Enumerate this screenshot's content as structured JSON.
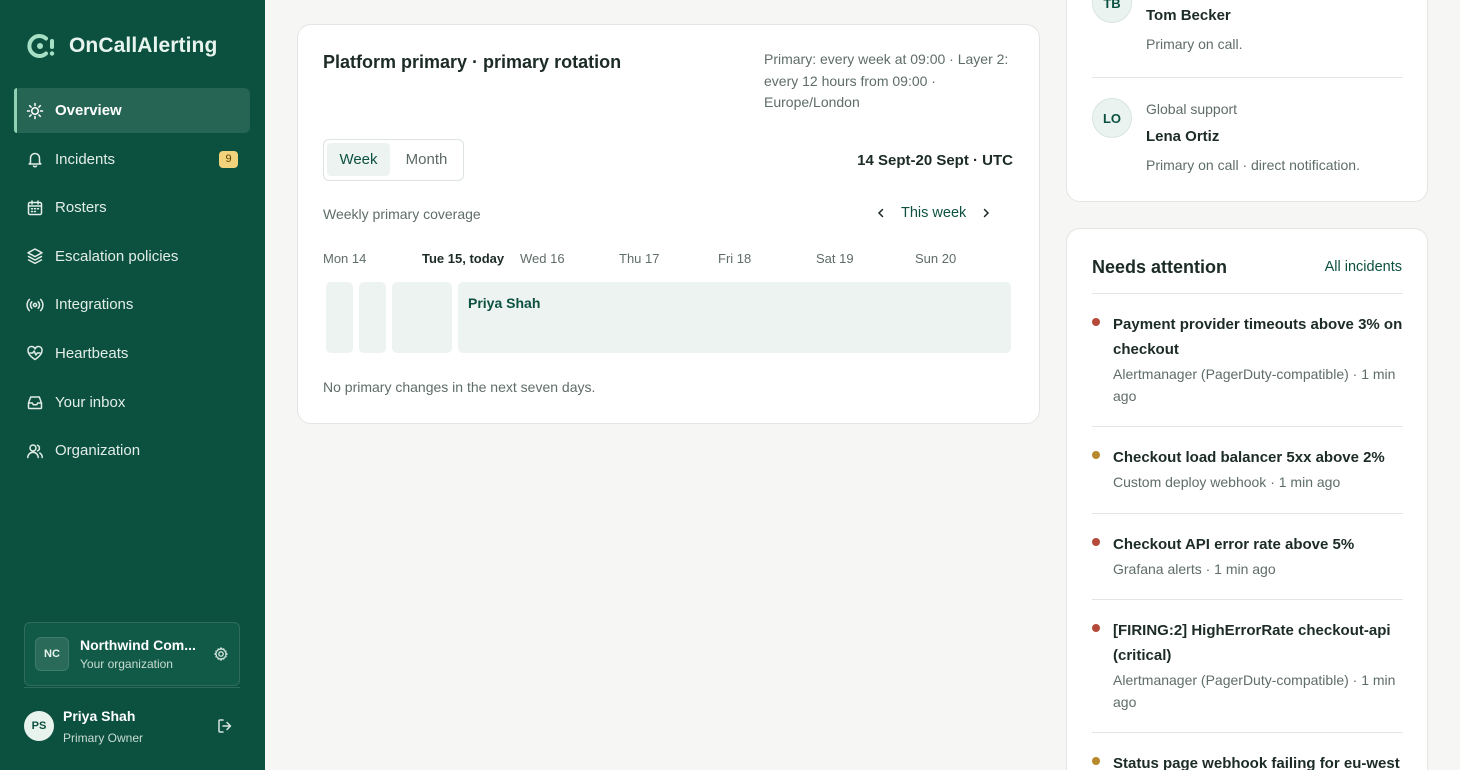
{
  "app": {
    "name": "OnCallAlerting"
  },
  "colors": {
    "sidebar": "#0c5140",
    "accent": "#0c5140",
    "critical": "#b54a3b",
    "warning": "#b8892a",
    "badge": "#f2d27a"
  },
  "nav": {
    "items": [
      {
        "label": "Overview",
        "icon": "sun-icon",
        "active": true
      },
      {
        "label": "Incidents",
        "icon": "bell-icon",
        "badge": "9"
      },
      {
        "label": "Rosters",
        "icon": "calendar-icon"
      },
      {
        "label": "Escalation policies",
        "icon": "layers-icon"
      },
      {
        "label": "Integrations",
        "icon": "broadcast-icon"
      },
      {
        "label": "Heartbeats",
        "icon": "heart-pulse-icon"
      },
      {
        "label": "Your inbox",
        "icon": "inbox-icon"
      },
      {
        "label": "Organization",
        "icon": "users-icon"
      }
    ]
  },
  "org": {
    "initials": "NC",
    "name": "Northwind Com...",
    "role": "Your organization"
  },
  "user": {
    "initials": "PS",
    "name": "Priya Shah",
    "role": "Primary Owner"
  },
  "rotation": {
    "title": "Platform primary · primary rotation",
    "schedule": "Primary: every week at 09:00 · Layer 2: every 12 hours from 09:00 · Europe/London",
    "view_tabs": [
      "Week",
      "Month"
    ],
    "active_tab": "Week",
    "range": "14 Sept-20 Sept · UTC",
    "coverage_label": "Weekly primary coverage",
    "nav_label": "This week",
    "days": [
      "Mon 14",
      "Tue 15, today",
      "Wed 16",
      "Thu 17",
      "Fri 18",
      "Sat 19",
      "Sun 20"
    ],
    "today_index": 1,
    "shift_name": "Priya Shah",
    "footer": "No primary changes in the next seven days."
  },
  "oncall": [
    {
      "initials": "TB",
      "label": "",
      "name": "Tom Becker",
      "note": "Primary on call."
    },
    {
      "initials": "LO",
      "label": "Global support",
      "name": "Lena Ortiz",
      "note": "Primary on call · direct notification."
    }
  ],
  "needs_attention": {
    "title": "Needs attention",
    "link": "All incidents",
    "incidents": [
      {
        "title": "Payment provider timeouts above 3% on checkout",
        "source": "Alertmanager (PagerDuty-compatible) · 1 min ago",
        "severity": "critical"
      },
      {
        "title": "Checkout load balancer 5xx above 2%",
        "source": "Custom deploy webhook · 1 min ago",
        "severity": "warning"
      },
      {
        "title": "Checkout API error rate above 5%",
        "source": "Grafana alerts · 1 min ago",
        "severity": "critical"
      },
      {
        "title": "[FIRING:2] HighErrorRate checkout-api (critical)",
        "source": "Alertmanager (PagerDuty-compatible) · 1 min ago",
        "severity": "critical"
      },
      {
        "title": "Status page webhook failing for eu-west",
        "source": "",
        "severity": "warning"
      }
    ]
  }
}
